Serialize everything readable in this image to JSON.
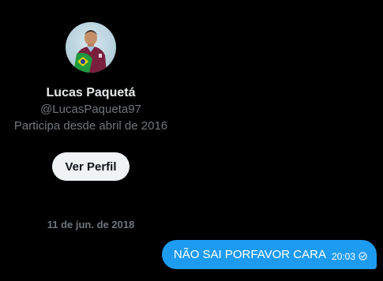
{
  "profile": {
    "name": "Lucas Paquetá",
    "handle": "@LucasPaqueta97",
    "joined": "Participa desde abril de 2016",
    "view_profile_label": "Ver Perfil"
  },
  "conversation": {
    "date_separator": "11 de jun. de 2018",
    "messages": [
      {
        "text": "NÃO SAI PORFAVOR CARA",
        "time": "20:03",
        "status_icon": "sent-check-icon"
      }
    ]
  },
  "colors": {
    "background": "#000000",
    "bubble": "#1d9bf0",
    "muted_text": "#71767b",
    "button_bg": "#eff3f4"
  }
}
